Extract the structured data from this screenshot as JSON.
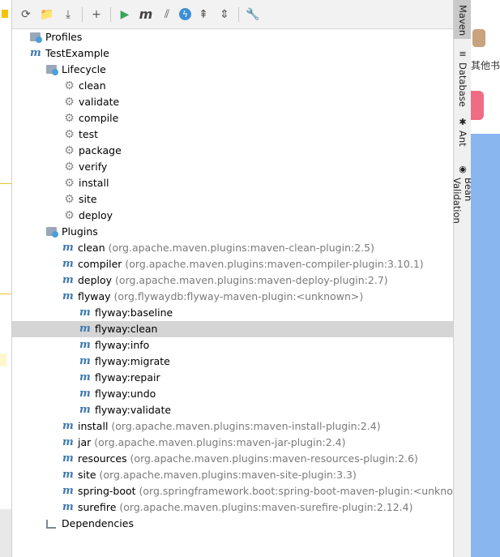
{
  "background_app": {
    "cn_text": "其他书"
  },
  "toolbar": {
    "buttons": [
      {
        "name": "reload-icon",
        "glyph": "⟳"
      },
      {
        "name": "add-maven-project-icon",
        "glyph": "📁"
      },
      {
        "name": "download-sources-icon",
        "glyph": "⤓"
      },
      {
        "name": "sep"
      },
      {
        "name": "plus-icon",
        "glyph": "+"
      },
      {
        "name": "sep"
      },
      {
        "name": "run-icon",
        "glyph": "▶"
      },
      {
        "name": "execute-goal-icon",
        "glyph": "m"
      },
      {
        "name": "toggle-offline-icon",
        "glyph": "⫽"
      },
      {
        "name": "skip-tests-icon",
        "glyph": "ϟ"
      },
      {
        "name": "show-dependencies-icon",
        "glyph": "⇞"
      },
      {
        "name": "collapse-all-icon",
        "glyph": "⇕"
      },
      {
        "name": "sep"
      },
      {
        "name": "settings-wrench-icon",
        "glyph": "🔧"
      }
    ]
  },
  "tree": [
    {
      "id": "profiles",
      "level": 0,
      "arrow": "›",
      "icon": "folder",
      "label": "Profiles"
    },
    {
      "id": "testexample",
      "level": 0,
      "arrow": "⌄",
      "icon": "m",
      "label": "TestExample"
    },
    {
      "id": "lifecycle",
      "level": 1,
      "arrow": "⌄",
      "icon": "folder",
      "label": "Lifecycle"
    },
    {
      "id": "lc-clean",
      "level": 3,
      "arrow": "",
      "icon": "gear",
      "label": "clean"
    },
    {
      "id": "lc-validate",
      "level": 3,
      "arrow": "",
      "icon": "gear",
      "label": "validate"
    },
    {
      "id": "lc-compile",
      "level": 3,
      "arrow": "",
      "icon": "gear",
      "label": "compile"
    },
    {
      "id": "lc-test",
      "level": 3,
      "arrow": "",
      "icon": "gear",
      "label": "test"
    },
    {
      "id": "lc-package",
      "level": 3,
      "arrow": "",
      "icon": "gear",
      "label": "package"
    },
    {
      "id": "lc-verify",
      "level": 3,
      "arrow": "",
      "icon": "gear",
      "label": "verify"
    },
    {
      "id": "lc-install",
      "level": 3,
      "arrow": "",
      "icon": "gear",
      "label": "install"
    },
    {
      "id": "lc-site",
      "level": 3,
      "arrow": "",
      "icon": "gear",
      "label": "site"
    },
    {
      "id": "lc-deploy",
      "level": 3,
      "arrow": "",
      "icon": "gear",
      "label": "deploy"
    },
    {
      "id": "plugins",
      "level": 1,
      "arrow": "⌄",
      "icon": "folder",
      "label": "Plugins"
    },
    {
      "id": "pl-clean",
      "level": 2,
      "arrow": "›",
      "icon": "m",
      "label": "clean",
      "coord": "(org.apache.maven.plugins:maven-clean-plugin:2.5)"
    },
    {
      "id": "pl-compiler",
      "level": 2,
      "arrow": "›",
      "icon": "m",
      "label": "compiler",
      "coord": "(org.apache.maven.plugins:maven-compiler-plugin:3.10.1)"
    },
    {
      "id": "pl-deploy",
      "level": 2,
      "arrow": "›",
      "icon": "m",
      "label": "deploy",
      "coord": "(org.apache.maven.plugins:maven-deploy-plugin:2.7)"
    },
    {
      "id": "pl-flyway",
      "level": 2,
      "arrow": "⌄",
      "icon": "m",
      "label": "flyway",
      "coord": "(org.flywaydb:flyway-maven-plugin:<unknown>)"
    },
    {
      "id": "fw-baseline",
      "level": 4,
      "arrow": "",
      "icon": "m",
      "label": "flyway:baseline"
    },
    {
      "id": "fw-clean",
      "level": 4,
      "arrow": "",
      "icon": "m",
      "label": "flyway:clean",
      "selected": true
    },
    {
      "id": "fw-info",
      "level": 4,
      "arrow": "",
      "icon": "m",
      "label": "flyway:info"
    },
    {
      "id": "fw-migrate",
      "level": 4,
      "arrow": "",
      "icon": "m",
      "label": "flyway:migrate"
    },
    {
      "id": "fw-repair",
      "level": 4,
      "arrow": "",
      "icon": "m",
      "label": "flyway:repair"
    },
    {
      "id": "fw-undo",
      "level": 4,
      "arrow": "",
      "icon": "m",
      "label": "flyway:undo"
    },
    {
      "id": "fw-validate",
      "level": 4,
      "arrow": "",
      "icon": "m",
      "label": "flyway:validate"
    },
    {
      "id": "pl-install",
      "level": 2,
      "arrow": "›",
      "icon": "m",
      "label": "install",
      "coord": "(org.apache.maven.plugins:maven-install-plugin:2.4)"
    },
    {
      "id": "pl-jar",
      "level": 2,
      "arrow": "›",
      "icon": "m",
      "label": "jar",
      "coord": "(org.apache.maven.plugins:maven-jar-plugin:2.4)"
    },
    {
      "id": "pl-resources",
      "level": 2,
      "arrow": "›",
      "icon": "m",
      "label": "resources",
      "coord": "(org.apache.maven.plugins:maven-resources-plugin:2.6)"
    },
    {
      "id": "pl-site",
      "level": 2,
      "arrow": "›",
      "icon": "m",
      "label": "site",
      "coord": "(org.apache.maven.plugins:maven-site-plugin:3.3)"
    },
    {
      "id": "pl-spring-boot",
      "level": 2,
      "arrow": "›",
      "icon": "m",
      "label": "spring-boot",
      "coord": "(org.springframework.boot:spring-boot-maven-plugin:<unknown>)"
    },
    {
      "id": "pl-surefire",
      "level": 2,
      "arrow": "›",
      "icon": "m",
      "label": "surefire",
      "coord": "(org.apache.maven.plugins:maven-surefire-plugin:2.12.4)"
    },
    {
      "id": "dependencies",
      "level": 1,
      "arrow": "›",
      "icon": "deps",
      "label": "Dependencies"
    }
  ],
  "tool_windows": [
    {
      "id": "maven",
      "label": "Maven",
      "icon": "",
      "active": true
    },
    {
      "id": "database",
      "label": "Database",
      "icon": "≡"
    },
    {
      "id": "ant",
      "label": "Ant",
      "icon": "✱"
    },
    {
      "id": "bean-validation",
      "label": "Bean Validation",
      "icon": "◉"
    }
  ],
  "colors": {
    "accent_blue": "#3d79b0",
    "selection": "#d5d5d5",
    "run_green": "#3aa55a"
  }
}
